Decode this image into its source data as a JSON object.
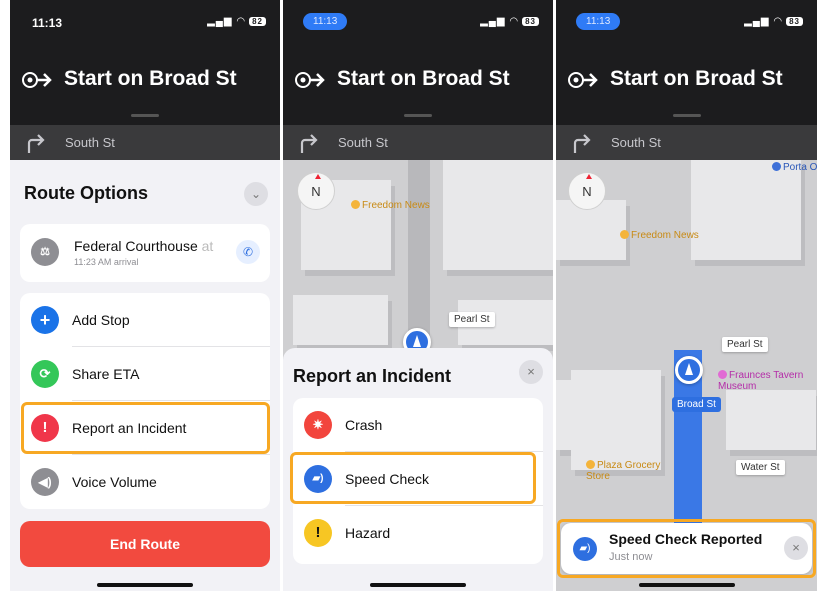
{
  "colors": {
    "highlight": "#f7a823",
    "accent": "#2e6fe0",
    "danger": "#f24a3f",
    "nav_bg": "#1c1c1e"
  },
  "screens": [
    {
      "status": {
        "time": "11:13",
        "battery": "82"
      },
      "nav": {
        "instruction": "Start on Broad St",
        "next_street": "South St"
      },
      "route_options": {
        "title": "Route Options",
        "destination": {
          "name": "Federal Courthouse",
          "suffix": "at",
          "arrival": "11:23 AM arrival",
          "icon": "courthouse-icon"
        },
        "items": [
          {
            "label": "Add Stop",
            "icon": "plus-icon",
            "color": "#1a73e8"
          },
          {
            "label": "Share ETA",
            "icon": "share-eta-icon",
            "color": "#34c759"
          },
          {
            "label": "Report an Incident",
            "icon": "report-icon",
            "color": "#f0364a"
          },
          {
            "label": "Voice Volume",
            "icon": "speaker-icon",
            "color": "#8e8e93"
          }
        ],
        "end_button": "End Route"
      }
    },
    {
      "status": {
        "time": "11:13",
        "battery": "83"
      },
      "nav": {
        "instruction": "Start on Broad St",
        "next_street": "South St"
      },
      "map": {
        "compass": "N",
        "pois": [
          "Freedom News"
        ],
        "streets": [
          "Pearl St"
        ]
      },
      "incident": {
        "title": "Report an Incident",
        "items": [
          {
            "label": "Crash",
            "icon": "crash-icon",
            "color": "#f2453d"
          },
          {
            "label": "Speed Check",
            "icon": "speed-camera-icon",
            "color": "#2e6fe0"
          },
          {
            "label": "Hazard",
            "icon": "hazard-icon",
            "color": "#f7c623"
          }
        ]
      }
    },
    {
      "status": {
        "time": "11:13",
        "battery": "83"
      },
      "nav": {
        "instruction": "Start on Broad St",
        "next_street": "South St"
      },
      "map": {
        "compass": "N",
        "pois": [
          "Freedom News",
          "Fraunces Tavern Museum",
          "Plaza Grocery Store",
          "Porta Old N"
        ],
        "streets": [
          "Pearl St",
          "Broad St",
          "Water St"
        ]
      },
      "toast": {
        "title": "Speed Check Reported",
        "subtitle": "Just now"
      }
    }
  ]
}
